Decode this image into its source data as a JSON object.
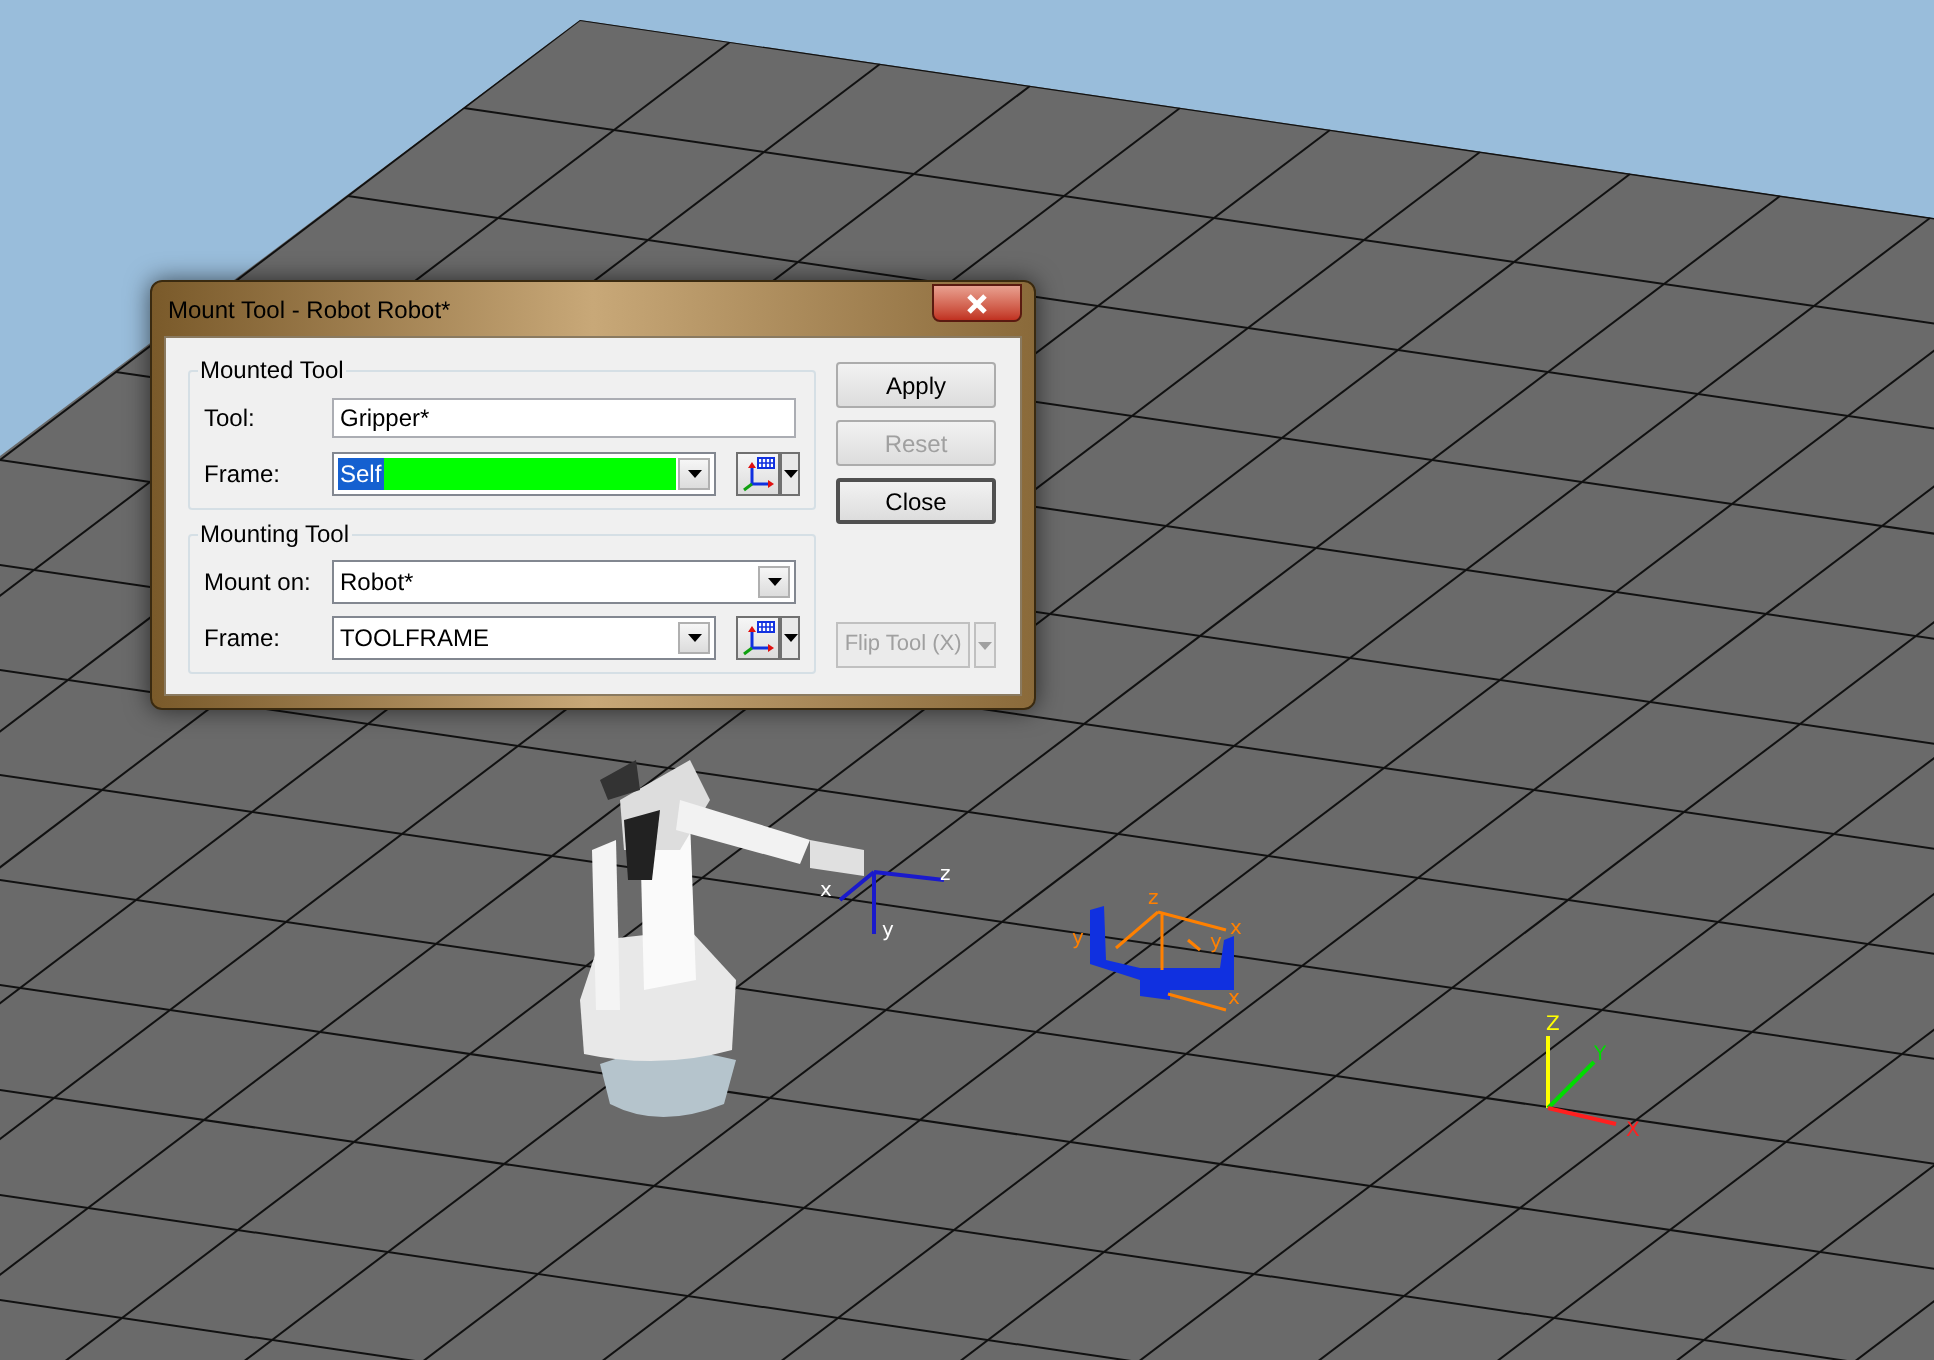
{
  "window": {
    "title": "Mount Tool - Robot Robot*"
  },
  "mounted_tool": {
    "legend": "Mounted Tool",
    "tool": {
      "label": "Tool:",
      "value": "Gripper*"
    },
    "frame": {
      "label": "Frame:",
      "value": "Self",
      "highlighted": true
    }
  },
  "mounting_tool": {
    "legend": "Mounting Tool",
    "mount_on": {
      "label": "Mount on:",
      "value": "Robot*"
    },
    "frame": {
      "label": "Frame:",
      "value": "TOOLFRAME",
      "highlighted": false
    }
  },
  "buttons": [
    {
      "label": "Apply",
      "disabled": false,
      "default": false
    },
    {
      "label": "Reset",
      "disabled": true,
      "default": false
    },
    {
      "label": "Close",
      "disabled": false,
      "default": true
    }
  ],
  "flip_button": {
    "label": "Flip Tool (X)",
    "disabled": true
  },
  "scene": {
    "robot_tool_axes": [
      "x",
      "z",
      "y"
    ],
    "gripper_axes": [
      "z",
      "y",
      "x",
      "y",
      "x"
    ],
    "world_axes": [
      "Z",
      "Y",
      "X"
    ]
  }
}
